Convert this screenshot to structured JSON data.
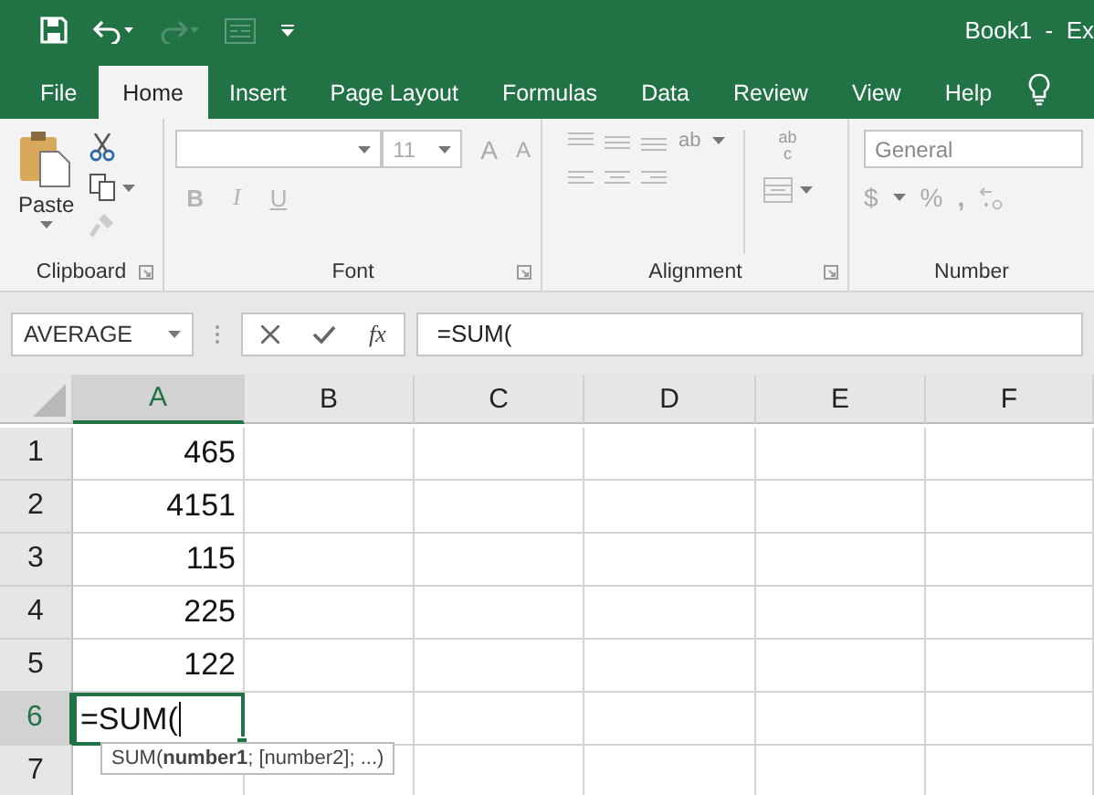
{
  "title_bar": {
    "document_title": "Book1  -  Ex"
  },
  "tabs": [
    {
      "label": "File",
      "selected": false
    },
    {
      "label": "Home",
      "selected": true
    },
    {
      "label": "Insert",
      "selected": false
    },
    {
      "label": "Page Layout",
      "selected": false
    },
    {
      "label": "Formulas",
      "selected": false
    },
    {
      "label": "Data",
      "selected": false
    },
    {
      "label": "Review",
      "selected": false
    },
    {
      "label": "View",
      "selected": false
    },
    {
      "label": "Help",
      "selected": false
    }
  ],
  "ribbon": {
    "clipboard": {
      "paste_label": "Paste",
      "label": "Clipboard"
    },
    "font": {
      "font_size": "11",
      "grow": "A",
      "shrink": "A",
      "bold": "B",
      "italic": "I",
      "underline": "U",
      "label": "Font"
    },
    "alignment": {
      "orientation": "ab",
      "wrap_top": "ab",
      "wrap_bottom": "c",
      "label": "Alignment"
    },
    "number": {
      "format": "General",
      "currency": "$",
      "percent": "%",
      "comma": ",",
      "label": "Number"
    }
  },
  "formula_bar": {
    "name_box": "AVERAGE",
    "function_label": "fx",
    "formula": "=SUM("
  },
  "columns": [
    {
      "label": "A",
      "selected": true
    },
    {
      "label": "B",
      "selected": false
    },
    {
      "label": "C",
      "selected": false
    },
    {
      "label": "D",
      "selected": false
    },
    {
      "label": "E",
      "selected": false
    },
    {
      "label": "F",
      "selected": false
    }
  ],
  "rows": [
    {
      "label": "1",
      "selected": false,
      "kind": "number",
      "value": "465"
    },
    {
      "label": "2",
      "selected": false,
      "kind": "number",
      "value": "4151"
    },
    {
      "label": "3",
      "selected": false,
      "kind": "number",
      "value": "115"
    },
    {
      "label": "4",
      "selected": false,
      "kind": "number",
      "value": "225"
    },
    {
      "label": "5",
      "selected": false,
      "kind": "number",
      "value": "122"
    },
    {
      "label": "6",
      "selected": true,
      "kind": "editing",
      "value": "=SUM("
    },
    {
      "label": "7",
      "selected": false,
      "kind": "empty"
    }
  ],
  "tooltip": "SUM(**number1**; [number2]; ...)"
}
